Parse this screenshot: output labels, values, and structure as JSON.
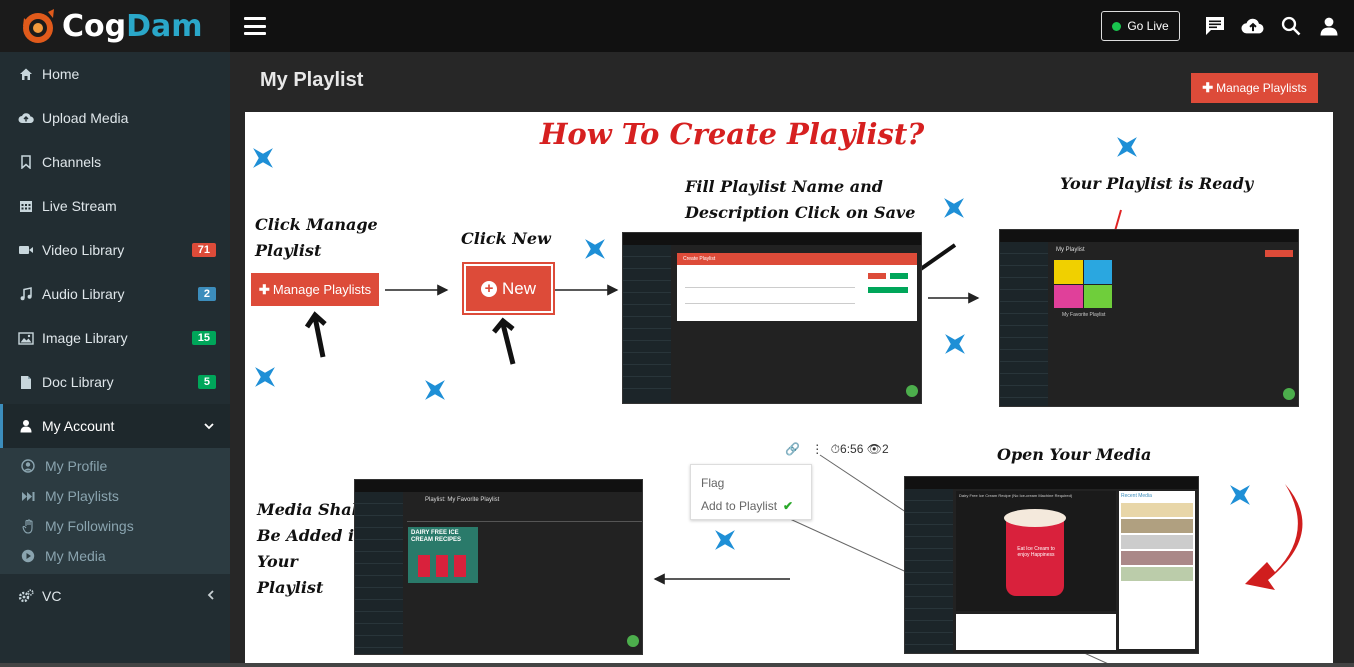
{
  "brand": {
    "part1": "Cog",
    "part2": "Dam"
  },
  "sidebar": {
    "items": [
      {
        "label": "Home",
        "icon": "home-icon"
      },
      {
        "label": "Upload Media",
        "icon": "cloud-upload-icon"
      },
      {
        "label": "Channels",
        "icon": "bookmark-icon"
      },
      {
        "label": "Live Stream",
        "icon": "calendar-icon"
      },
      {
        "label": "Video Library",
        "icon": "video-camera-icon",
        "badge": "71"
      },
      {
        "label": "Audio Library",
        "icon": "music-icon",
        "badge": "2"
      },
      {
        "label": "Image Library",
        "icon": "image-icon",
        "badge": "15"
      },
      {
        "label": "Doc Library",
        "icon": "file-icon",
        "badge": "5"
      },
      {
        "label": "My Account",
        "icon": "user-icon"
      },
      {
        "label": "VC",
        "icon": "cogs-icon"
      }
    ],
    "submenu": [
      {
        "label": "My Profile",
        "icon": "user-circle-icon"
      },
      {
        "label": "My Playlists",
        "icon": "fast-forward-icon"
      },
      {
        "label": "My Followings",
        "icon": "hand-icon"
      },
      {
        "label": "My Media",
        "icon": "play-circle-icon"
      }
    ]
  },
  "topbar": {
    "go_live": "Go Live"
  },
  "page": {
    "title": "My Playlist",
    "manage_button": "Manage Playlists"
  },
  "guide": {
    "title": "How To Create Playlist?",
    "step1": "Click Manage Playlist",
    "step1_button": "Manage Playlists",
    "step2": "Click New",
    "step2_button": "New",
    "step3": "Fill Playlist Name and Description Click on Save",
    "step4": "Your Playlist is Ready",
    "step5": "Open Your Media",
    "step6": "Media Shall Be Added in Your Playlist",
    "menu_flag": "Flag",
    "menu_add": "Add to Playlist",
    "media_duration": "6:56",
    "media_views": "2",
    "mini_create_title": "Create Playlist",
    "mini_playlist_heading": "My Playlist",
    "mini_playlist_item": "My Favorite Playlist",
    "mini_playlist_page": "Playlist: My Favorite Playlist",
    "mini_video_title": "Dairy Free Ice Cream Recipe (No Ice-cream Machine Required)",
    "mini_cup_text": "Eat Ice Cream to enjoy Happiness",
    "mini_thumb_text": "DAIRY FREE ICE CREAM RECIPES",
    "mini_recent": "Recent Media"
  },
  "colors": {
    "accent_red": "#dd4b39",
    "sidebar_bg": "#222d32",
    "topbar_bg": "#111111",
    "title_red": "#d62020",
    "star_blue": "#1e8fd6"
  }
}
